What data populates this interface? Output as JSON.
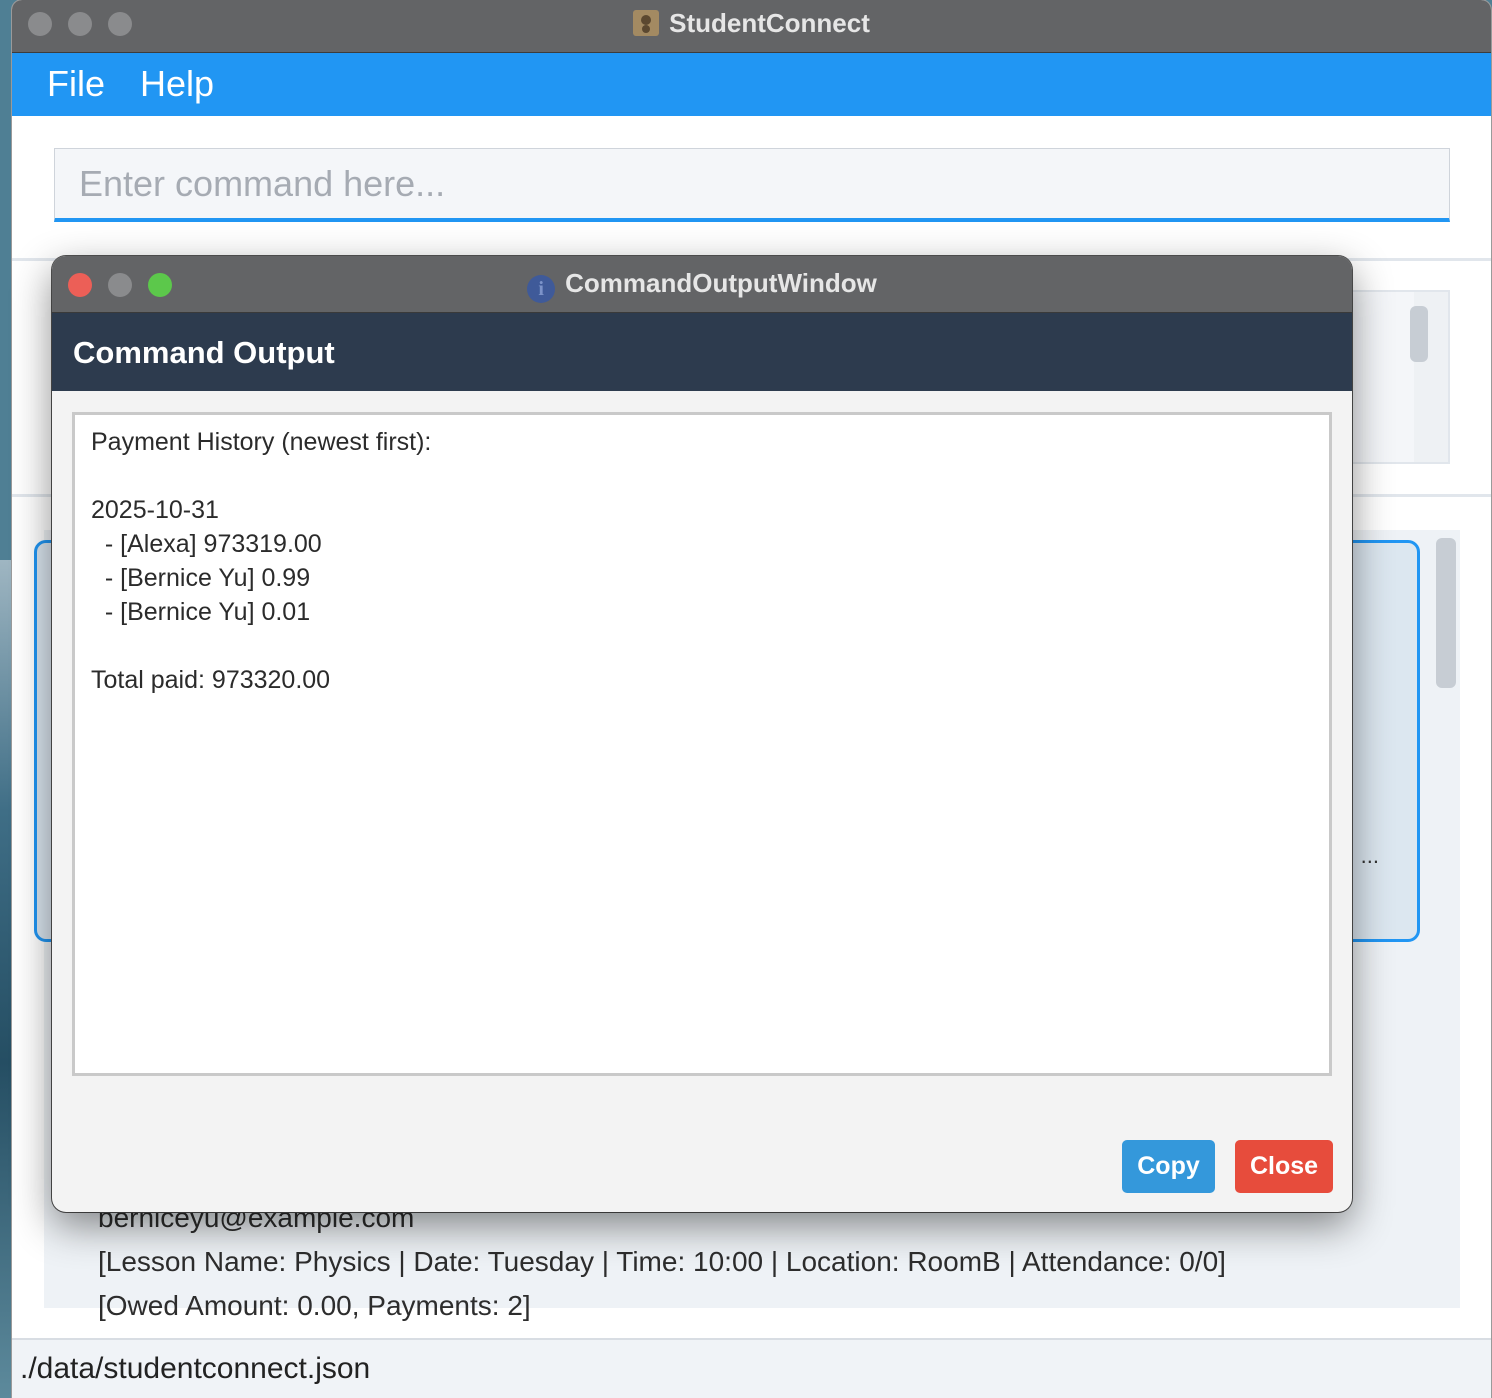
{
  "app": {
    "title": "StudentConnect",
    "icon": "contacts-book-icon"
  },
  "menu": {
    "file_label": "File",
    "help_label": "Help"
  },
  "command": {
    "placeholder": "Enter command here...",
    "value": ""
  },
  "person_card": {
    "email": "berniceyu@example.com",
    "lesson": "[Lesson Name: Physics | Date: Tuesday | Time: 10:00 | Location: RoomB | Attendance: 0/0]",
    "payment": "[Owed Amount: 0.00, Payments: 2]",
    "ellipsis": "..."
  },
  "status": {
    "file_path": "./data/studentconnect.json"
  },
  "dialog": {
    "window_title": "CommandOutputWindow",
    "icon": "info-icon",
    "header": "Command Output",
    "output_lines": [
      "Payment History (newest first):",
      "",
      "2025-10-31",
      "  - [Alexa] 973319.00",
      "  - [Bernice Yu] 0.99",
      "  - [Bernice Yu] 0.01",
      "",
      "Total paid: 973320.00"
    ],
    "copy_label": "Copy",
    "close_label": "Close"
  },
  "colors": {
    "accent": "#2196f3",
    "dialog_header": "#2d3b4e",
    "copy_button": "#3498db",
    "close_button": "#e74c3c",
    "traffic_red": "#ec5f57",
    "traffic_yellow": "#8a8b8d",
    "traffic_green": "#5cc84b"
  }
}
